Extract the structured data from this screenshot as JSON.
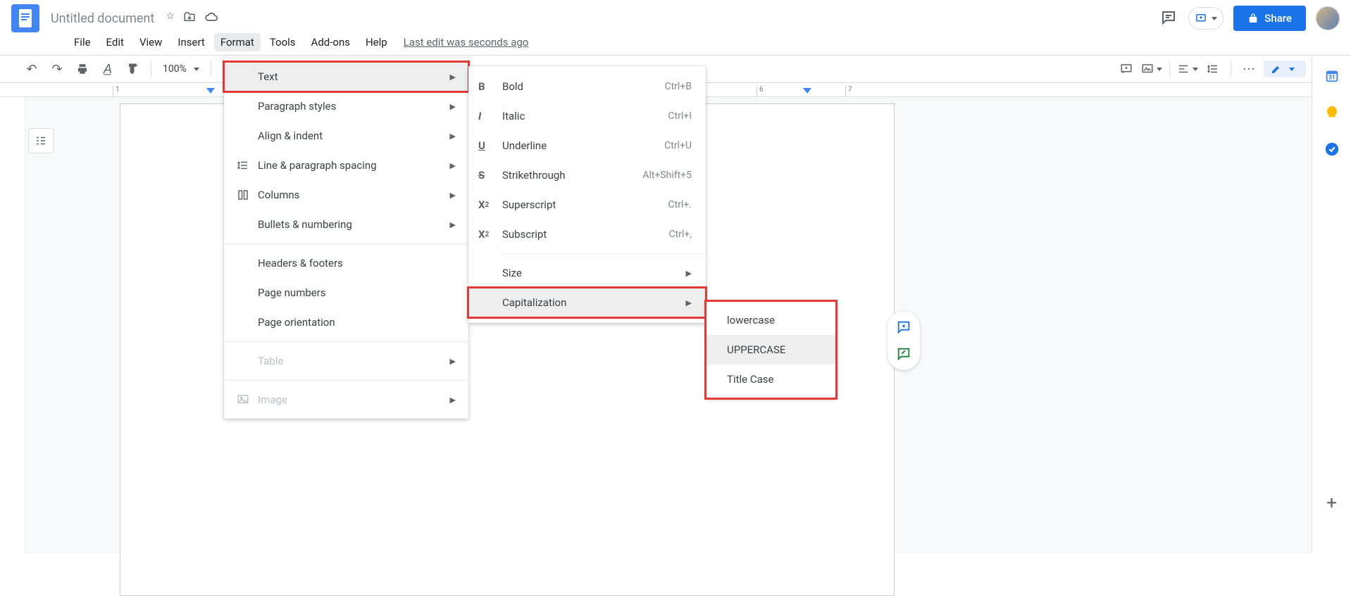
{
  "header": {
    "doc_title": "Untitled document",
    "last_edit": "Last edit was seconds ago",
    "share_label": "Share"
  },
  "menubar": {
    "items": [
      "File",
      "Edit",
      "View",
      "Insert",
      "Format",
      "Tools",
      "Add-ons",
      "Help"
    ],
    "open_index": 4
  },
  "toolbar": {
    "zoom": "100%"
  },
  "ruler": {
    "marks": [
      "1",
      "6",
      "7"
    ]
  },
  "format_menu": {
    "items": [
      {
        "label": "Text",
        "icon": "",
        "arrow": true,
        "highlight": true,
        "redbox": true
      },
      {
        "label": "Paragraph styles",
        "icon": "",
        "arrow": true
      },
      {
        "label": "Align & indent",
        "icon": "",
        "arrow": true
      },
      {
        "label": "Line & paragraph spacing",
        "icon": "line-spacing",
        "arrow": true
      },
      {
        "label": "Columns",
        "icon": "columns",
        "arrow": true
      },
      {
        "label": "Bullets & numbering",
        "icon": "",
        "arrow": true
      },
      {
        "divider": true
      },
      {
        "label": "Headers & footers",
        "icon": ""
      },
      {
        "label": "Page numbers",
        "icon": ""
      },
      {
        "label": "Page orientation",
        "icon": ""
      },
      {
        "divider": true
      },
      {
        "label": "Table",
        "icon": "",
        "arrow": true,
        "disabled": true
      },
      {
        "divider": true
      },
      {
        "label": "Image",
        "icon": "image",
        "arrow": true,
        "disabled": true
      }
    ]
  },
  "text_submenu": {
    "items": [
      {
        "icon": "B",
        "label": "Bold",
        "shortcut": "Ctrl+B"
      },
      {
        "icon": "I",
        "label": "Italic",
        "shortcut": "Ctrl+I",
        "italic": true
      },
      {
        "icon": "U",
        "label": "Underline",
        "shortcut": "Ctrl+U",
        "underline": true
      },
      {
        "icon": "S",
        "label": "Strikethrough",
        "shortcut": "Alt+Shift+5",
        "strike": true
      },
      {
        "icon": "X²",
        "label": "Superscript",
        "shortcut": "Ctrl+."
      },
      {
        "icon": "X₂",
        "label": "Subscript",
        "shortcut": "Ctrl+,"
      },
      {
        "divider": true
      },
      {
        "label": "Size",
        "arrow": true
      },
      {
        "label": "Capitalization",
        "arrow": true,
        "highlight": true,
        "redbox": true
      }
    ]
  },
  "cap_submenu": {
    "items": [
      {
        "label": "lowercase"
      },
      {
        "label": "UPPERCASE",
        "highlight": true
      },
      {
        "label": "Title Case"
      }
    ],
    "redbox": true
  }
}
